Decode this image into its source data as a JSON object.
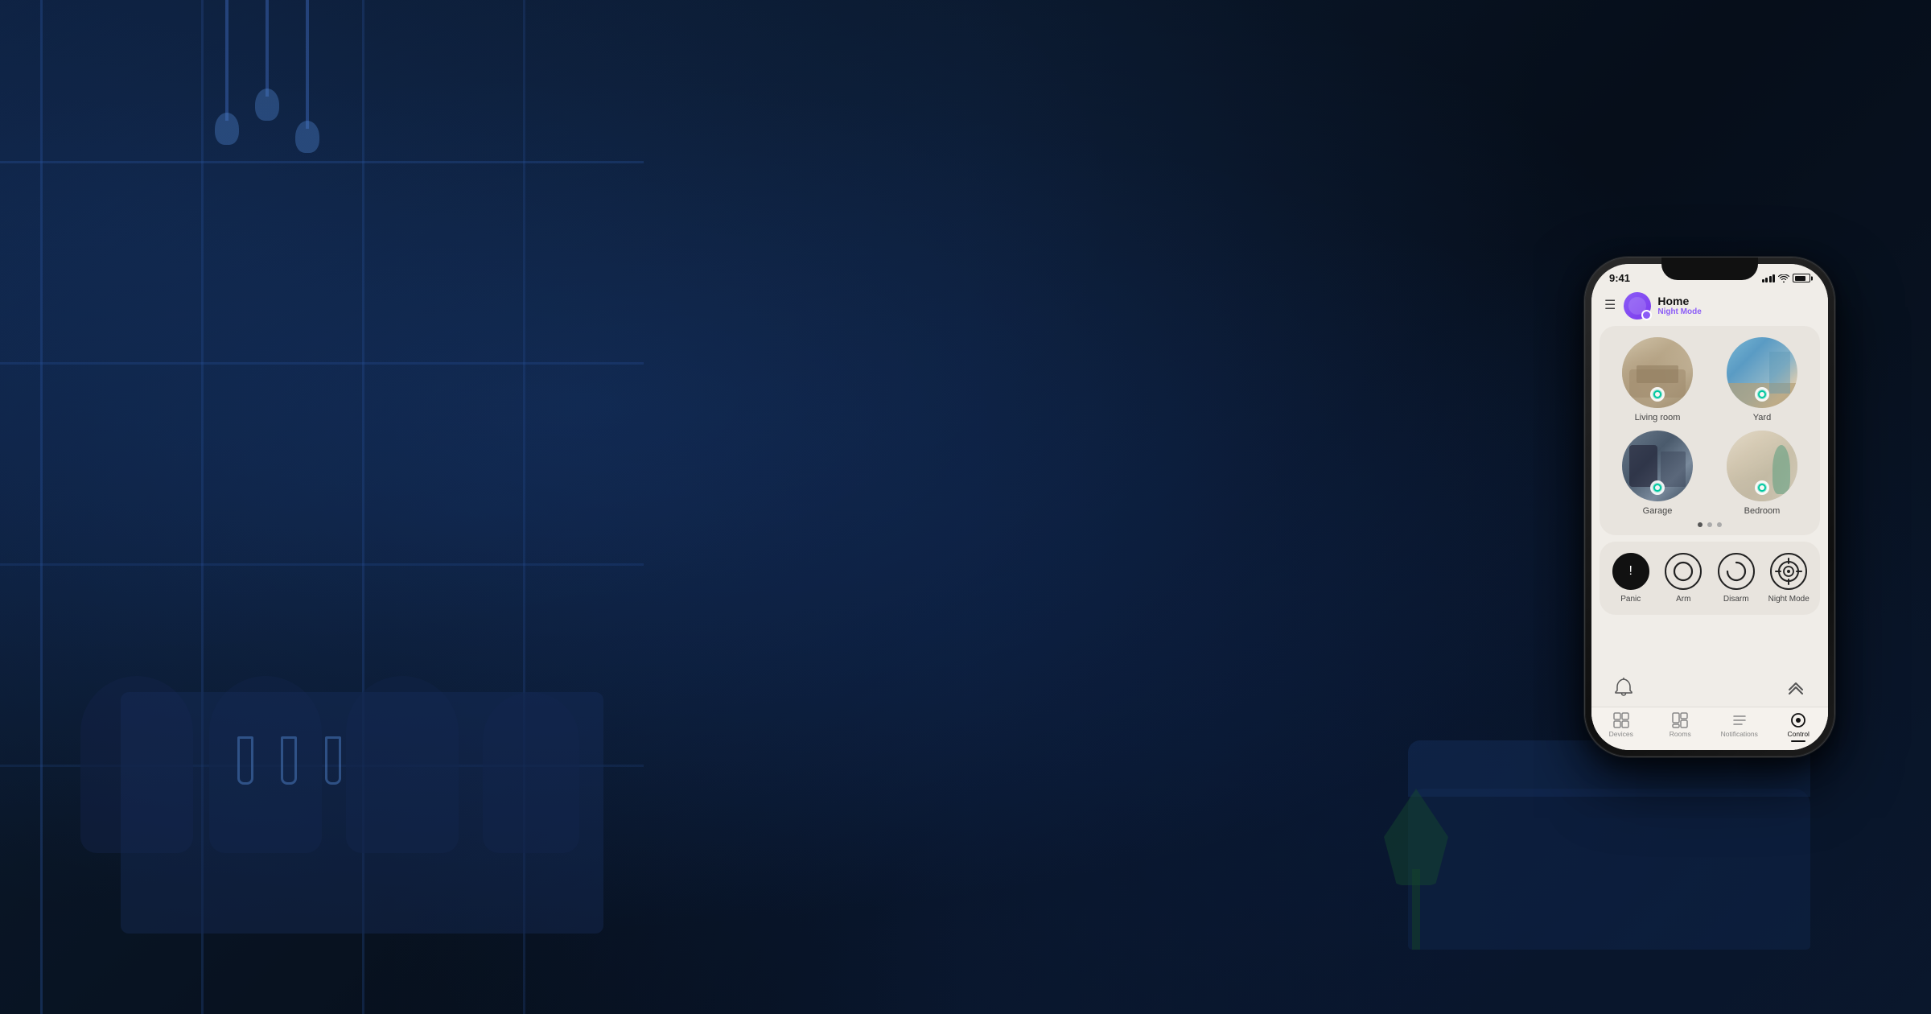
{
  "background": {
    "description": "Dark blue night dining room scene"
  },
  "phone": {
    "status_bar": {
      "time": "9:41",
      "signal": "signal",
      "wifi": "wifi",
      "battery": "battery"
    },
    "header": {
      "menu_icon": "☰",
      "title": "Home",
      "subtitle": "Night Mode"
    },
    "rooms": {
      "items": [
        {
          "label": "Living room",
          "img": "living"
        },
        {
          "label": "Yard",
          "img": "yard"
        },
        {
          "label": "Garage",
          "img": "garage"
        },
        {
          "label": "Bedroom",
          "img": "bedroom"
        }
      ],
      "pagination": [
        "active",
        "inactive",
        "inactive"
      ]
    },
    "security": {
      "buttons": [
        {
          "id": "panic",
          "label": "Panic",
          "type": "panic"
        },
        {
          "id": "arm",
          "label": "Arm",
          "type": "arm"
        },
        {
          "id": "disarm",
          "label": "Disarm",
          "type": "disarm"
        },
        {
          "id": "nightmode",
          "label": "Night Mode",
          "type": "nightmode"
        }
      ]
    },
    "bottom": {
      "bell_icon": "🔔",
      "arrow_icon": "⌃"
    },
    "tabs": [
      {
        "id": "devices",
        "label": "Devices",
        "active": false
      },
      {
        "id": "rooms",
        "label": "Rooms",
        "active": false
      },
      {
        "id": "notifications",
        "label": "Notifications",
        "active": false
      },
      {
        "id": "control",
        "label": "Control",
        "active": true
      }
    ]
  }
}
